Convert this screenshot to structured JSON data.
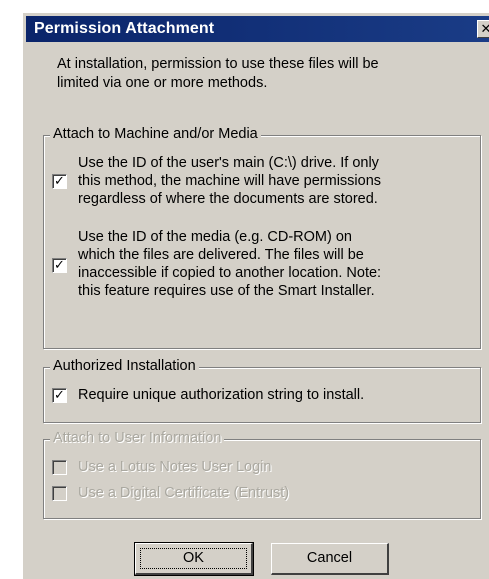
{
  "dialog": {
    "title": "Permission Attachment",
    "close_glyph": "✕",
    "intro": "At installation, permission to use these files will be\nlimited via one or more methods."
  },
  "groups": {
    "machine_media": {
      "legend": "Attach to Machine and/or Media",
      "drive_option": {
        "checked": true,
        "text": "Use the ID of the user's main (C:\\) drive. If only\nthis method, the machine will have permissions\nregardless of where the documents are stored."
      },
      "media_option": {
        "checked": true,
        "text": "Use the ID of the media (e.g. CD-ROM) on\nwhich the files are delivered. The files will be\ninaccessible if copied to another location. Note:\nthis feature requires use of the Smart Installer."
      }
    },
    "authorized": {
      "legend": "Authorized Installation",
      "require_option": {
        "checked": true,
        "text": "Require unique authorization string to install."
      }
    },
    "user_info": {
      "legend": "Attach to User Information",
      "disabled": true,
      "lotus_option": {
        "checked": false,
        "text": "Use a Lotus Notes User Login"
      },
      "cert_option": {
        "checked": false,
        "text": "Use a Digital Certificate (Entrust)"
      }
    }
  },
  "buttons": {
    "ok_label": "OK",
    "cancel_label": "Cancel"
  },
  "icons": {
    "checked_glyph": "✓"
  },
  "colors": {
    "titlebar": "#0a246a",
    "dialog_bg": "#d4d0c8",
    "disabled_text": "#aaa8a0"
  }
}
